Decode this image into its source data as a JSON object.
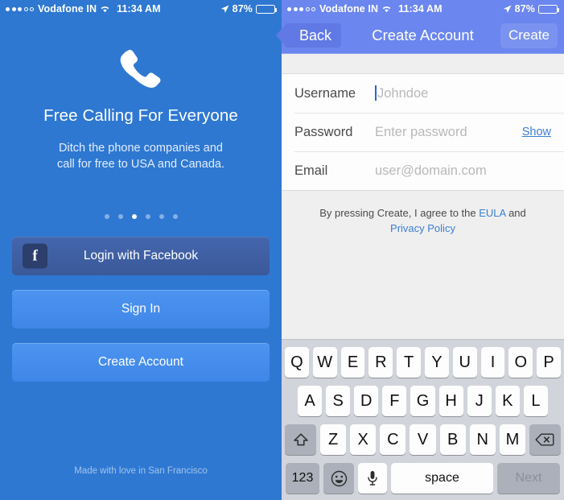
{
  "status_bar": {
    "carrier": "Vodafone IN",
    "time": "11:34 AM",
    "battery_text": "87%",
    "battery_percent": 87,
    "signal_dots_filled": 3,
    "signal_dots_total": 5,
    "wifi_icon": "wifi-icon",
    "location_icon": "location-arrow-icon",
    "battery_icon": "battery-icon"
  },
  "left_screen": {
    "background_color": "#2E78D2",
    "phone_icon": "phone-handset-icon",
    "title": "Free Calling For Everyone",
    "subtitle_line1": "Ditch the phone companies and",
    "subtitle_line2": "call for free to USA and Canada.",
    "pager": {
      "total": 6,
      "active_index": 2
    },
    "facebook_button": {
      "label": "Login with Facebook",
      "glyph": "f",
      "icon": "facebook-icon"
    },
    "sign_in_button": "Sign In",
    "create_account_button": "Create Account",
    "footer": "Made with love in San Francisco"
  },
  "right_screen": {
    "nav": {
      "back_label": "Back",
      "title": "Create Account",
      "create_label": "Create",
      "bar_color": "#6B86EE"
    },
    "form": {
      "fields": [
        {
          "label": "Username",
          "value": "",
          "placeholder": "Johndoe",
          "focused": true,
          "action": null
        },
        {
          "label": "Password",
          "value": "",
          "placeholder": "Enter password",
          "focused": false,
          "action": "Show"
        },
        {
          "label": "Email",
          "value": "",
          "placeholder": "user@domain.com",
          "focused": false,
          "action": null
        }
      ]
    },
    "legal": {
      "prefix": "By pressing Create, I agree to the ",
      "link1": "EULA",
      "middle": " and",
      "link2": "Privacy Policy",
      "link_color": "#3B7FD4"
    },
    "keyboard": {
      "row1": [
        "Q",
        "W",
        "E",
        "R",
        "T",
        "Y",
        "U",
        "I",
        "O",
        "P"
      ],
      "row2": [
        "A",
        "S",
        "D",
        "F",
        "G",
        "H",
        "J",
        "K",
        "L"
      ],
      "row3": [
        "Z",
        "X",
        "C",
        "V",
        "B",
        "N",
        "M"
      ],
      "shift_icon": "shift-arrow-icon",
      "backspace_icon": "backspace-icon",
      "numbers_key": "123",
      "emoji_icon": "smiley-face-icon",
      "mic_icon": "microphone-icon",
      "space_key": "space",
      "return_key": "Next"
    }
  }
}
